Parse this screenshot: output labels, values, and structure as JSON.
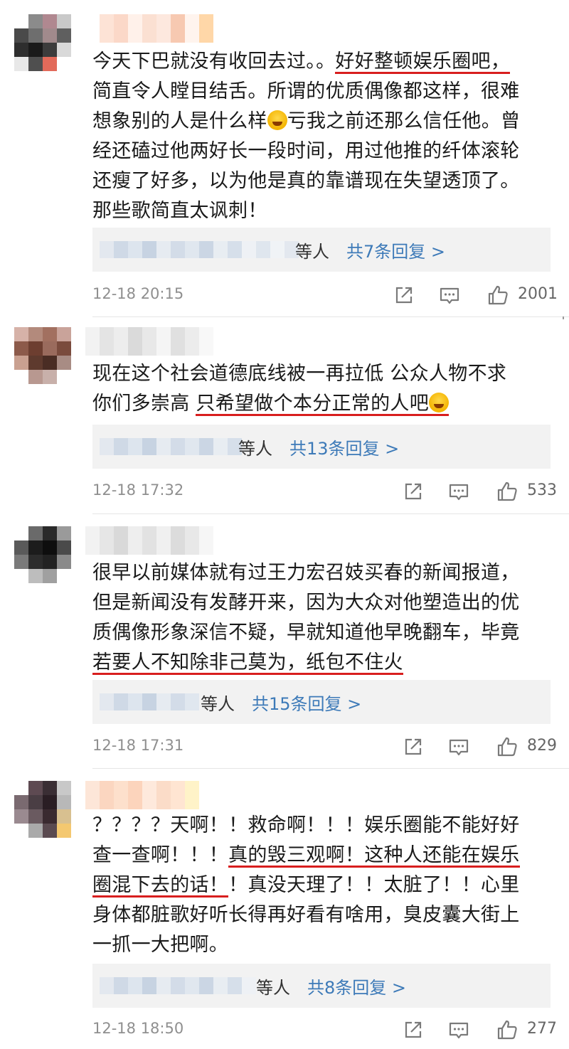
{
  "colors": {
    "underline": "#d81e1e",
    "link": "#3d7ab8",
    "meta": "#8f8f8f",
    "reply_bg": "#f2f2f2"
  },
  "comments": [
    {
      "lines": [
        {
          "pre": "今天下巴就没有收回去过。。",
          "ul": "好好整顿娱乐圈吧，",
          "post": ""
        },
        {
          "pre": "简直令人瞠目结舌。所谓的优质偶像都这样，很难",
          "ul": "",
          "post": ""
        },
        {
          "pre": "想象别的人是什么样",
          "emoji": true,
          "post": "亏我之前还那么信任他。曾"
        },
        {
          "pre": "经还磕过他两好长一段时间，用过他推的纤体滚轮",
          "ul": "",
          "post": ""
        },
        {
          "pre": "还瘦了好多，以为他是真的靠谱现在失望透顶了。",
          "ul": "",
          "post": ""
        },
        {
          "pre": "那些歌简直太讽刺！",
          "ul": "",
          "post": ""
        }
      ],
      "reply_others": "等人",
      "reply_count": "共7条回复 >",
      "time": "12-18 20:15",
      "likes": "2001"
    },
    {
      "lines": [
        {
          "pre": "现在这个社会道德底线被一再拉低  公众人物不求",
          "ul": "",
          "post": ""
        },
        {
          "pre": "你们多崇高 ",
          "ul": "只希望做个本分正常的人吧",
          "emoji_ul": true,
          "post": ""
        }
      ],
      "reply_others": "等人",
      "reply_count": "共13条回复 >",
      "time": "12-18 17:32",
      "likes": "533"
    },
    {
      "lines": [
        {
          "pre": "很早以前媒体就有过王力宏召妓买春的新闻报道，",
          "ul": "",
          "post": ""
        },
        {
          "pre": "但是新闻没有发酵开来，因为大众对他塑造出的优",
          "ul": "",
          "post": ""
        },
        {
          "pre": "质偶像形象深信不疑，早就知道他早晚翻车，毕竟",
          "ul": "",
          "post": ""
        },
        {
          "pre": "",
          "ul": "若要人不知除非己莫为，纸包不住火",
          "post": ""
        }
      ],
      "reply_others": "等人",
      "reply_count": "共15条回复 >",
      "time": "12-18 17:31",
      "likes": "829"
    },
    {
      "lines": [
        {
          "pre": "？？？？天啊！！救命啊！！！娱乐圈能不能好好",
          "ul": "",
          "post": ""
        },
        {
          "pre": "查一查啊！！！",
          "ul": "真的毁三观啊！这种人还能在娱乐",
          "post": ""
        },
        {
          "pre": "",
          "ul": "圈混下去的话！",
          "post": "！真没天理了！！太脏了！！心里"
        },
        {
          "pre": "身体都脏歌好听长得再好看有啥用，臭皮囊大街上",
          "ul": "",
          "post": ""
        },
        {
          "pre": "一抓一大把啊。",
          "ul": "",
          "post": ""
        }
      ],
      "reply_others": "等人",
      "reply_count": "共8条回复 >",
      "time": "12-18 18:50",
      "likes": "277"
    }
  ]
}
